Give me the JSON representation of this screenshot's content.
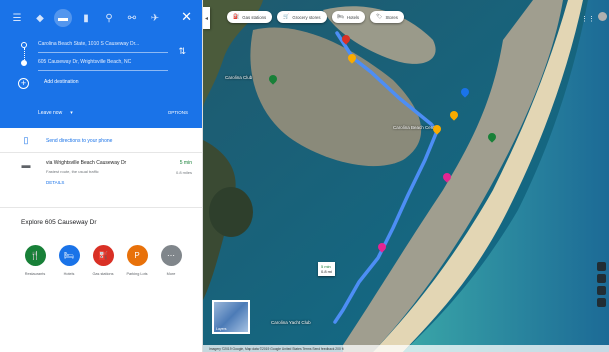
{
  "directions": {
    "modes": [
      {
        "name": "best-mode-icon",
        "glyph": "◆"
      },
      {
        "name": "car-mode-icon",
        "glyph": "▬"
      },
      {
        "name": "transit-mode-icon",
        "glyph": "▮"
      },
      {
        "name": "walk-mode-icon",
        "glyph": "⚲"
      },
      {
        "name": "bike-mode-icon",
        "glyph": "⚯"
      },
      {
        "name": "flight-mode-icon",
        "glyph": "✈"
      }
    ],
    "close_glyph": "✕",
    "origin": "Carolina Beach State, 1010 S Causeway Dr...",
    "destination": "605 Causeway Dr, Wrightsville Beach, NC",
    "add_destination": "Add destination",
    "leave_now": "Leave now",
    "options": "OPTIONS",
    "send_to_phone": "Send directions to your phone",
    "route": {
      "title": "via Wrightsville Beach Causeway Dr",
      "subtitle": "Fastest route, the usual traffic",
      "details": "DETAILS",
      "time": "5 min",
      "distance": "0.8 miles"
    },
    "explore_title": "Explore 605 Causeway Dr",
    "categories": [
      {
        "label": "Restaurants",
        "color": "#188038",
        "glyph": "🍴",
        "name": "restaurants-button"
      },
      {
        "label": "Hotels",
        "color": "#1a73e8",
        "glyph": "🛏",
        "name": "hotels-button"
      },
      {
        "label": "Gas stations",
        "color": "#d93025",
        "glyph": "⛽",
        "name": "gas-stations-button"
      },
      {
        "label": "Parking Lots",
        "color": "#e8710a",
        "glyph": "P",
        "name": "parking-lots-button"
      },
      {
        "label": "More",
        "color": "#80868b",
        "glyph": "⋯",
        "name": "more-button"
      }
    ]
  },
  "map": {
    "chips": [
      {
        "label": "Gas stations",
        "glyph": "⛽",
        "name": "chip-gas-stations"
      },
      {
        "label": "Grocery stores",
        "glyph": "🛒",
        "name": "chip-grocery-stores"
      },
      {
        "label": "Hotels",
        "glyph": "🛏",
        "name": "chip-hotels"
      },
      {
        "label": "Stores",
        "glyph": "🏷",
        "name": "chip-stores"
      }
    ],
    "labels": {
      "place_left": "Carolina Club",
      "place_mid": "Carolina Beach Center",
      "place_bottom": "Carolina Yacht Club"
    },
    "tooltip": {
      "time": "5 min",
      "dist": "0.8 mi"
    },
    "layers_label": "Layers",
    "footer": "Imagery ©2019 Google, Map data ©2019 Google   United States   Terms   Send feedback   200 ft"
  }
}
